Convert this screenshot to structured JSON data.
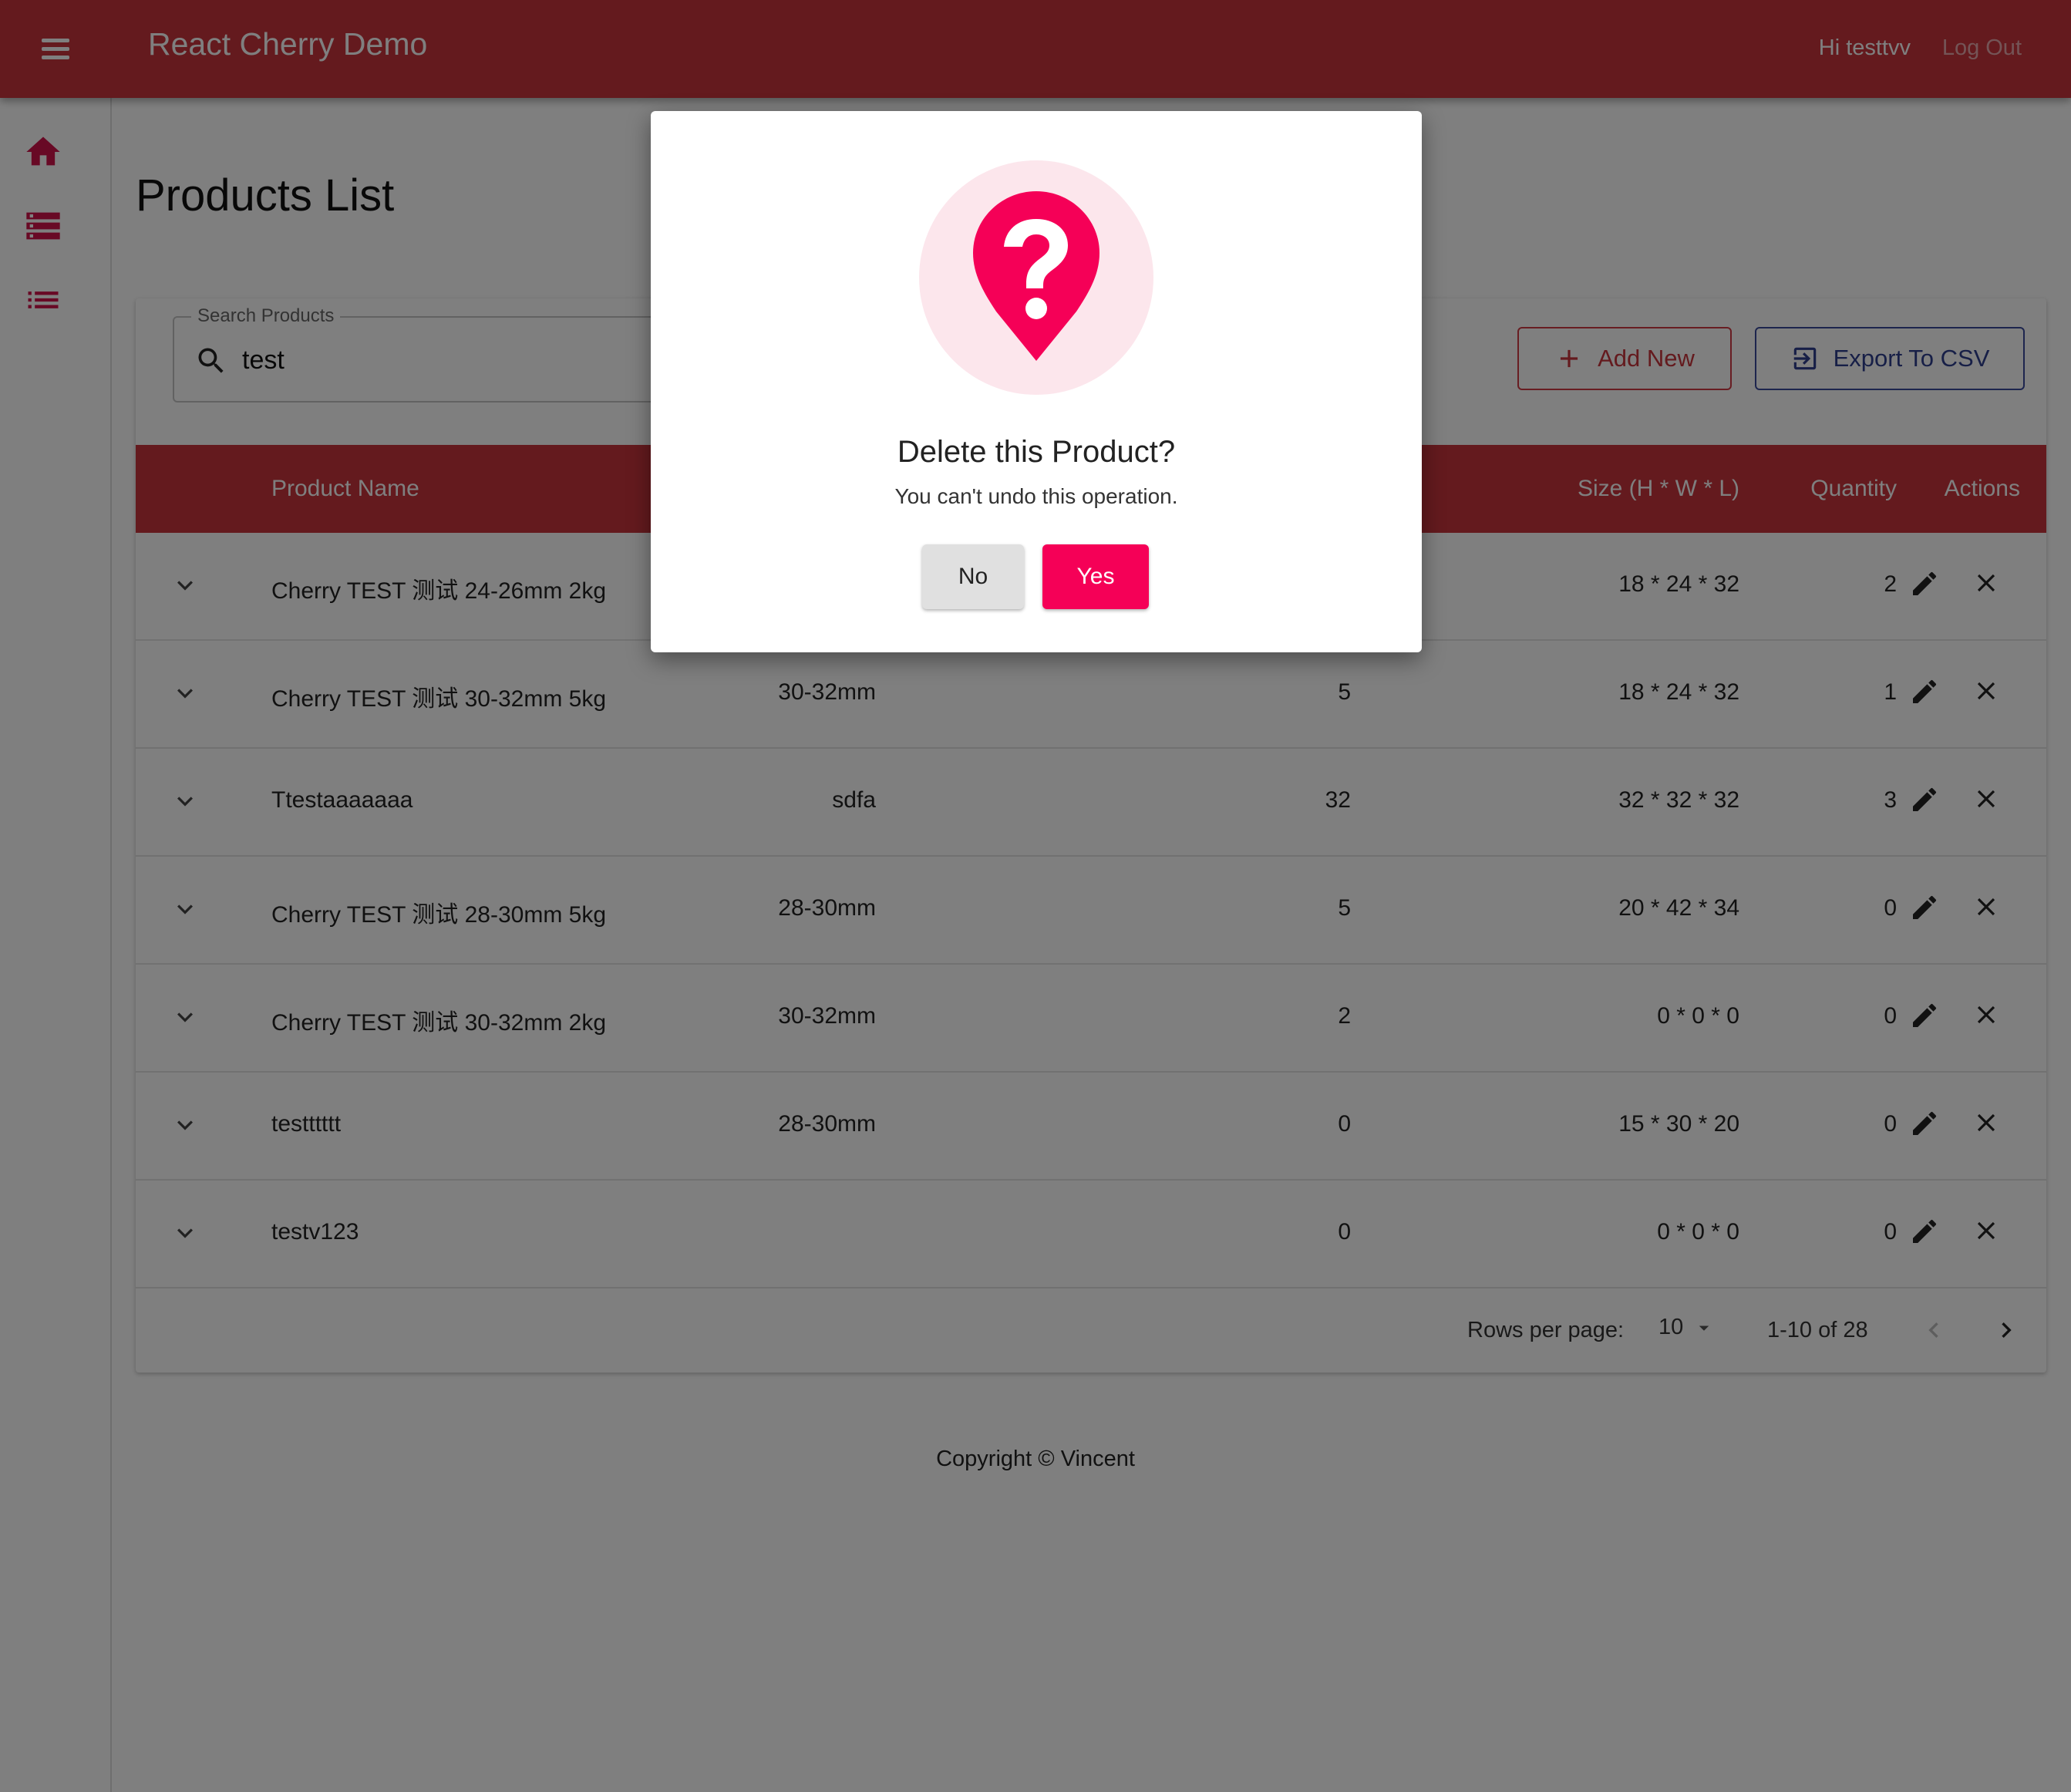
{
  "app": {
    "title": "React Cherry Demo",
    "greeting": "Hi testtvv",
    "logout_label": "Log Out"
  },
  "sidebar": {
    "items": [
      {
        "icon": "home-icon"
      },
      {
        "icon": "storage-icon"
      },
      {
        "icon": "list-icon"
      }
    ]
  },
  "page": {
    "title": "Products List"
  },
  "search": {
    "legend": "Search Products",
    "value": "test"
  },
  "toolbar": {
    "add_label": "Add New",
    "export_label": "Export To CSV"
  },
  "table": {
    "headers": {
      "name": "Product Name",
      "size": "Size (H * W * L)",
      "quantity": "Quantity",
      "actions": "Actions"
    },
    "rows": [
      {
        "name": "Cherry TEST 测试 24-26mm 2kg",
        "spec": "",
        "weight": "",
        "size": "18 * 24 * 32",
        "quantity": "2"
      },
      {
        "name": "Cherry TEST 测试 30-32mm 5kg",
        "spec": "30-32mm",
        "weight": "5",
        "size": "18 * 24 * 32",
        "quantity": "1"
      },
      {
        "name": "Ttestaaaaaaa",
        "spec": "sdfa",
        "weight": "32",
        "size": "32 * 32 * 32",
        "quantity": "3"
      },
      {
        "name": "Cherry TEST 测试 28-30mm 5kg",
        "spec": "28-30mm",
        "weight": "5",
        "size": "20 * 42 * 34",
        "quantity": "0"
      },
      {
        "name": "Cherry TEST 测试 30-32mm 2kg",
        "spec": "30-32mm",
        "weight": "2",
        "size": "0 * 0 * 0",
        "quantity": "0"
      },
      {
        "name": "testttttt",
        "spec": "28-30mm",
        "weight": "0",
        "size": "15 * 30 * 20",
        "quantity": "0"
      },
      {
        "name": "testv123",
        "spec": "",
        "weight": "0",
        "size": "0 * 0 * 0",
        "quantity": "0"
      }
    ]
  },
  "pagination": {
    "rows_per_page_label": "Rows per page:",
    "rows_per_page": "10",
    "range": "1-10 of 28"
  },
  "footer": {
    "copyright": "Copyright © Vincent"
  },
  "dialog": {
    "title": "Delete this Product?",
    "subtitle": "You can't undo this operation.",
    "no_label": "No",
    "yes_label": "Yes"
  },
  "colors": {
    "primary": "#c8353d",
    "accent": "#f50057",
    "nav_icon": "#d1124a",
    "export": "#2e3f8f"
  }
}
